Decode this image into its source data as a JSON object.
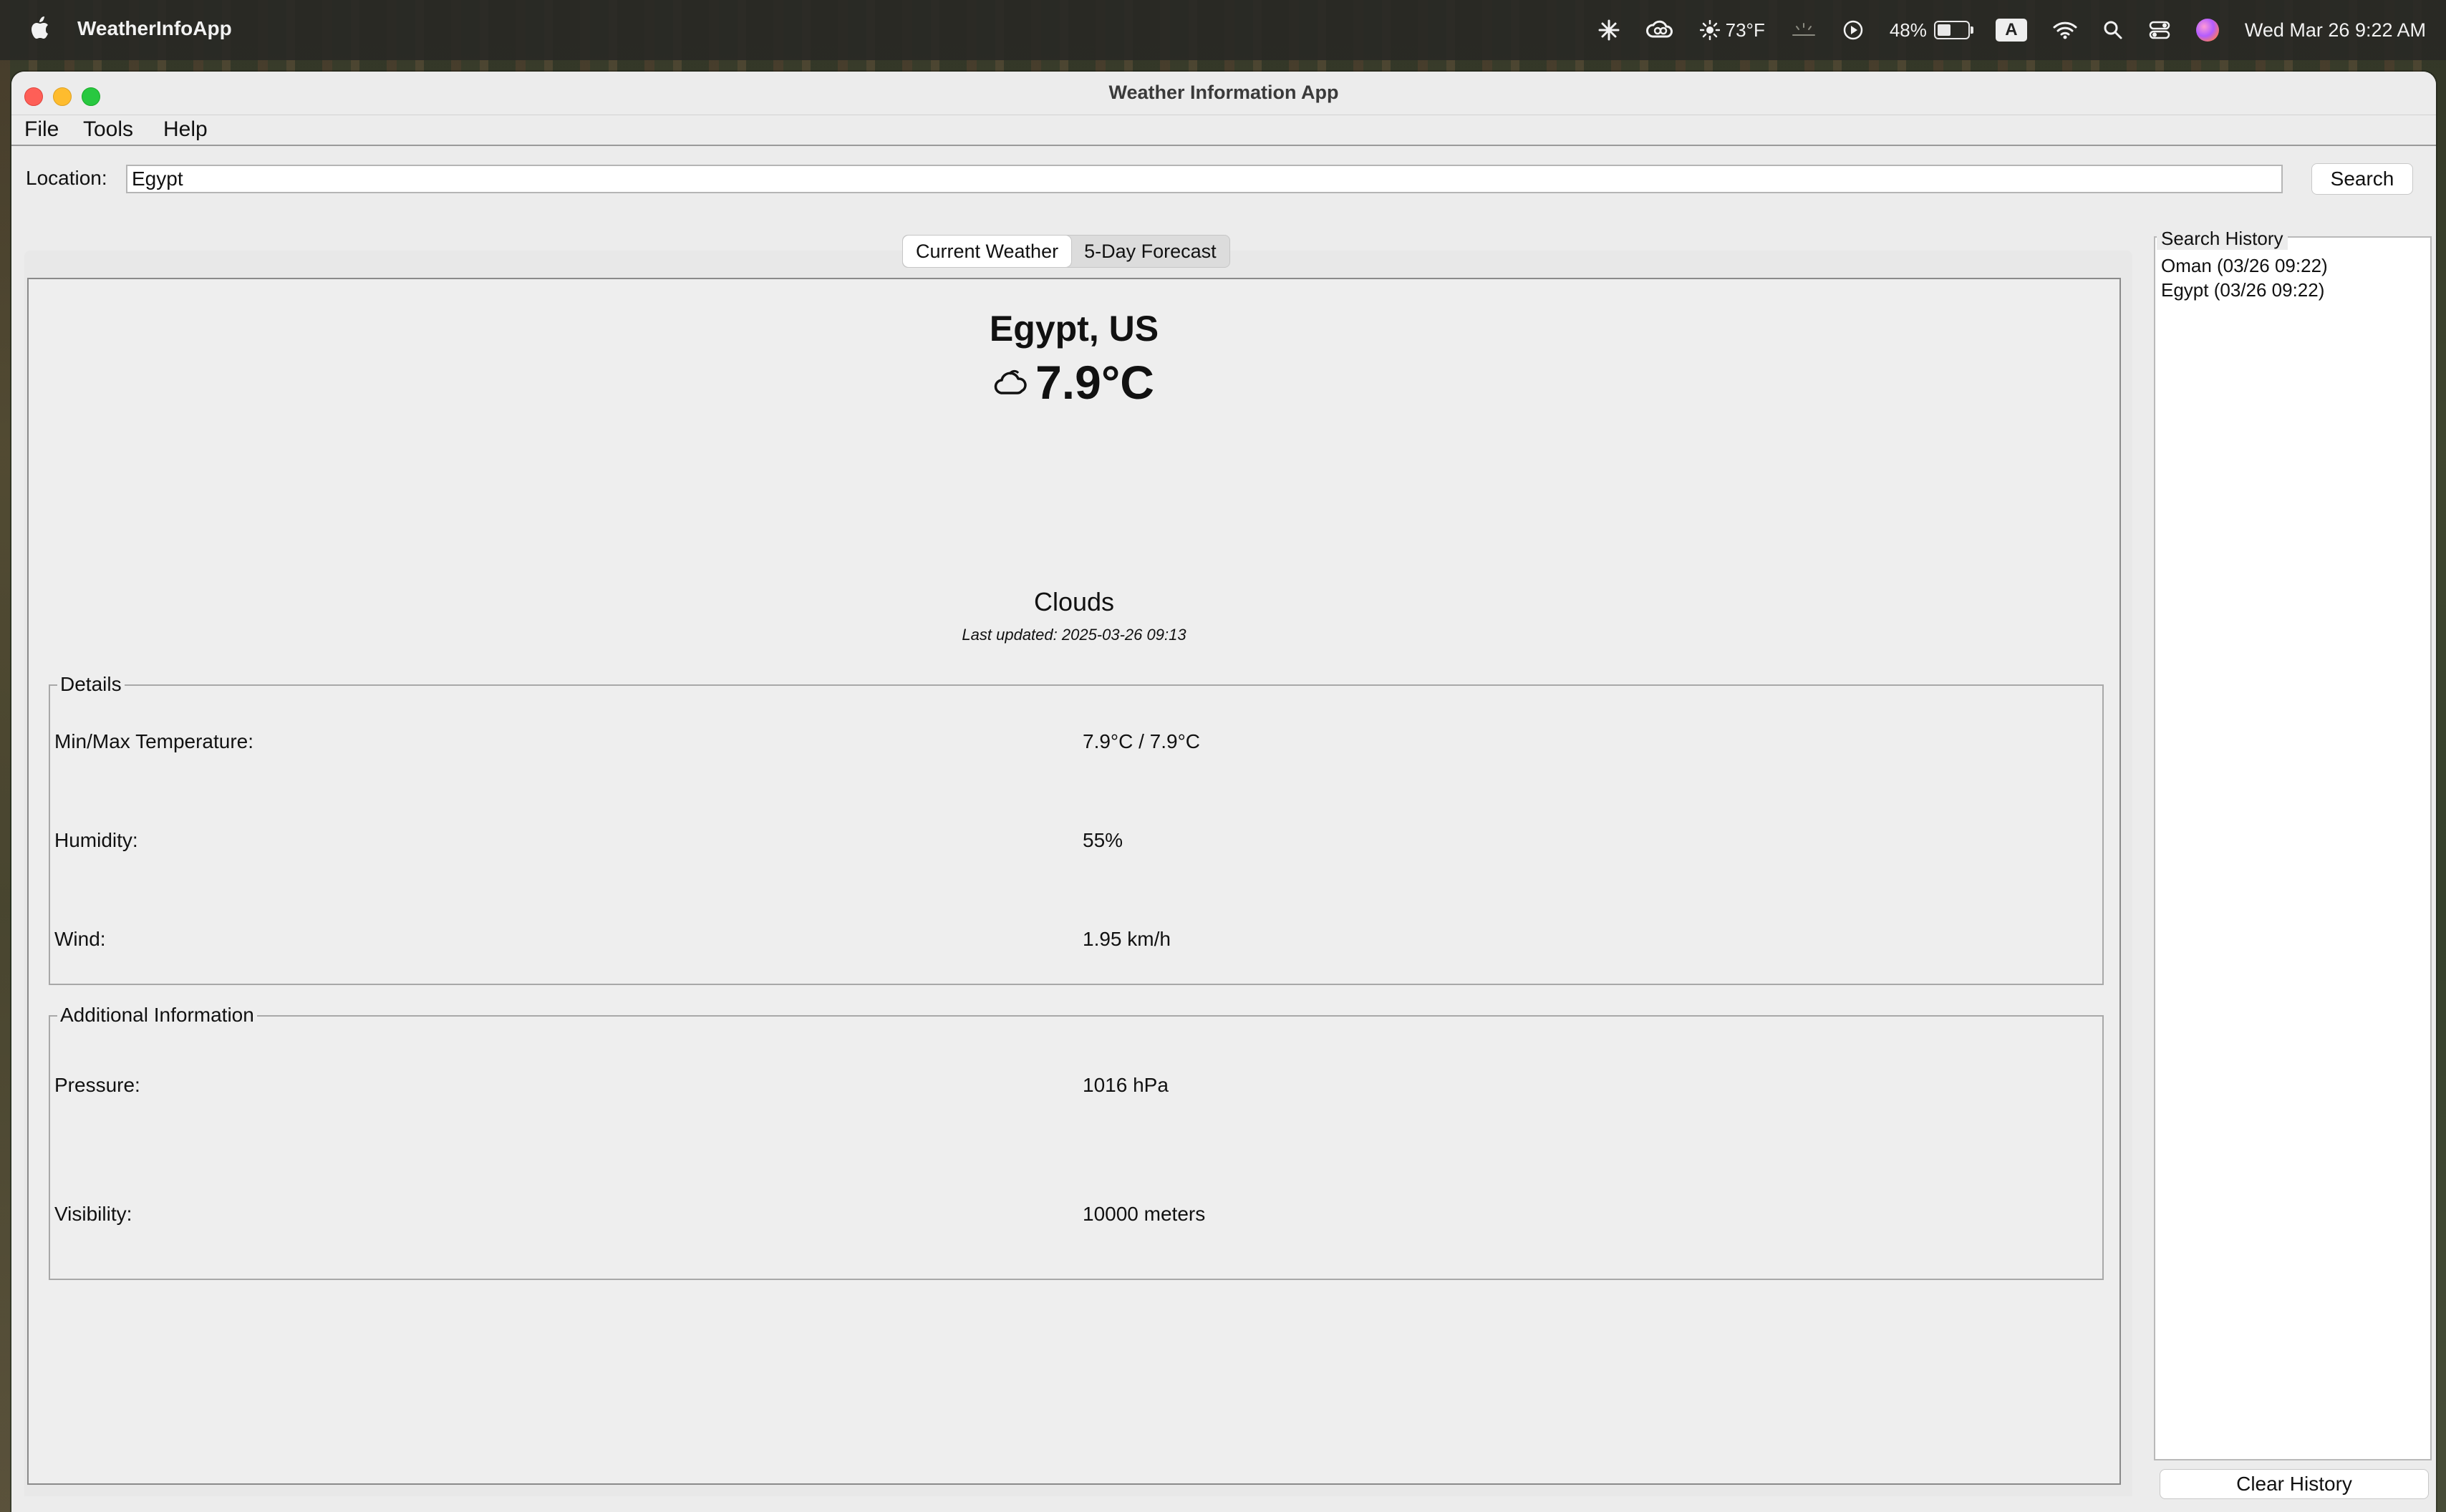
{
  "menubar": {
    "app_name": "WeatherInfoApp",
    "weather_temp": "73°F",
    "battery_percent": "48%",
    "battery_level": 0.48,
    "input_source": "A",
    "datetime": "Wed Mar 26  9:22 AM"
  },
  "window": {
    "title": "Weather Information App",
    "menu": {
      "file": "File",
      "tools": "Tools",
      "help": "Help"
    }
  },
  "search": {
    "label": "Location:",
    "value": "Egypt",
    "button": "Search"
  },
  "tabs": {
    "current": "Current Weather",
    "forecast": "5-Day Forecast"
  },
  "current": {
    "location": "Egypt, US",
    "temperature": "7.9°C",
    "icon": "cloud-icon",
    "condition": "Clouds",
    "last_updated": "Last updated: 2025-03-26 09:13"
  },
  "details": {
    "title": "Details",
    "minmax_label": "Min/Max Temperature:",
    "minmax_value": "7.9°C / 7.9°C",
    "humidity_label": "Humidity:",
    "humidity_value": "55%",
    "wind_label": "Wind:",
    "wind_value": "1.95 km/h"
  },
  "additional": {
    "title": "Additional Information",
    "pressure_label": "Pressure:",
    "pressure_value": "1016 hPa",
    "visibility_label": "Visibility:",
    "visibility_value": "10000 meters"
  },
  "history": {
    "title": "Search History",
    "items": [
      "Oman (03/26 09:22)",
      "Egypt (03/26 09:22)"
    ],
    "clear_button": "Clear History"
  }
}
